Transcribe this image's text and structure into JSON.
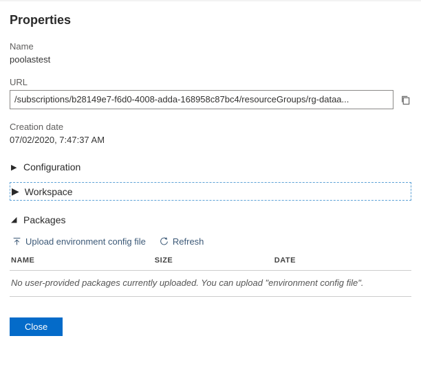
{
  "header": {
    "title": "Properties"
  },
  "fields": {
    "name_label": "Name",
    "name_value": "poolastest",
    "url_label": "URL",
    "url_value": "/subscriptions/b28149e7-f6d0-4008-adda-168958c87bc4/resourceGroups/rg-dataa...",
    "created_label": "Creation date",
    "created_value": "07/02/2020, 7:47:37 AM"
  },
  "sections": {
    "configuration_label": "Configuration",
    "workspace_label": "Workspace",
    "packages_label": "Packages"
  },
  "packages": {
    "upload_label": "Upload environment config file",
    "refresh_label": "Refresh",
    "col_name": "NAME",
    "col_size": "SIZE",
    "col_date": "DATE",
    "empty_text": "No user-provided packages currently uploaded. You can upload \"environment config file\"."
  },
  "footer": {
    "close_label": "Close"
  }
}
